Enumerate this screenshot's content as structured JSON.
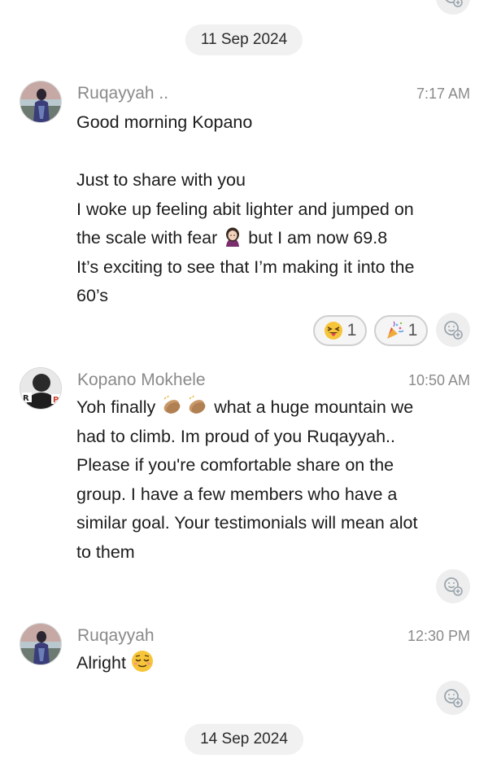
{
  "dates": [
    "11 Sep 2024",
    "14 Sep 2024"
  ],
  "messages": [
    {
      "sender": "Ruqayyah ..",
      "time": "7:17 AM",
      "lines": [
        "Good morning Kopano",
        "",
        "Just to share with you",
        "I woke up feeling abit lighter and jumped on",
        "the scale with fear",
        "but I am now 69.8",
        "It’s exciting to see that I’m making it into the",
        "60’s"
      ],
      "reactions": [
        {
          "icon": "squinting-tongue-emoji",
          "count": "1"
        },
        {
          "icon": "party-popper-emoji",
          "count": "1"
        }
      ]
    },
    {
      "sender": "Kopano Mokhele",
      "time": "10:50 AM",
      "lines": [
        "Yoh finally",
        "what a huge mountain we",
        "had to climb. Im proud of you Ruqayyah..",
        "Please if you're comfortable share on the",
        "group. I have a few members who have a",
        "similar goal. Your testimonials will mean alot",
        "to them"
      ]
    },
    {
      "sender": "Ruqayyah",
      "time": "12:30 PM",
      "lines": [
        "Alright"
      ]
    }
  ],
  "colors": {
    "background": "#ffffff",
    "pill": "#f1f1f1",
    "muted_text": "#8a8a8a",
    "emoji_yellow": "#f7c53a"
  }
}
